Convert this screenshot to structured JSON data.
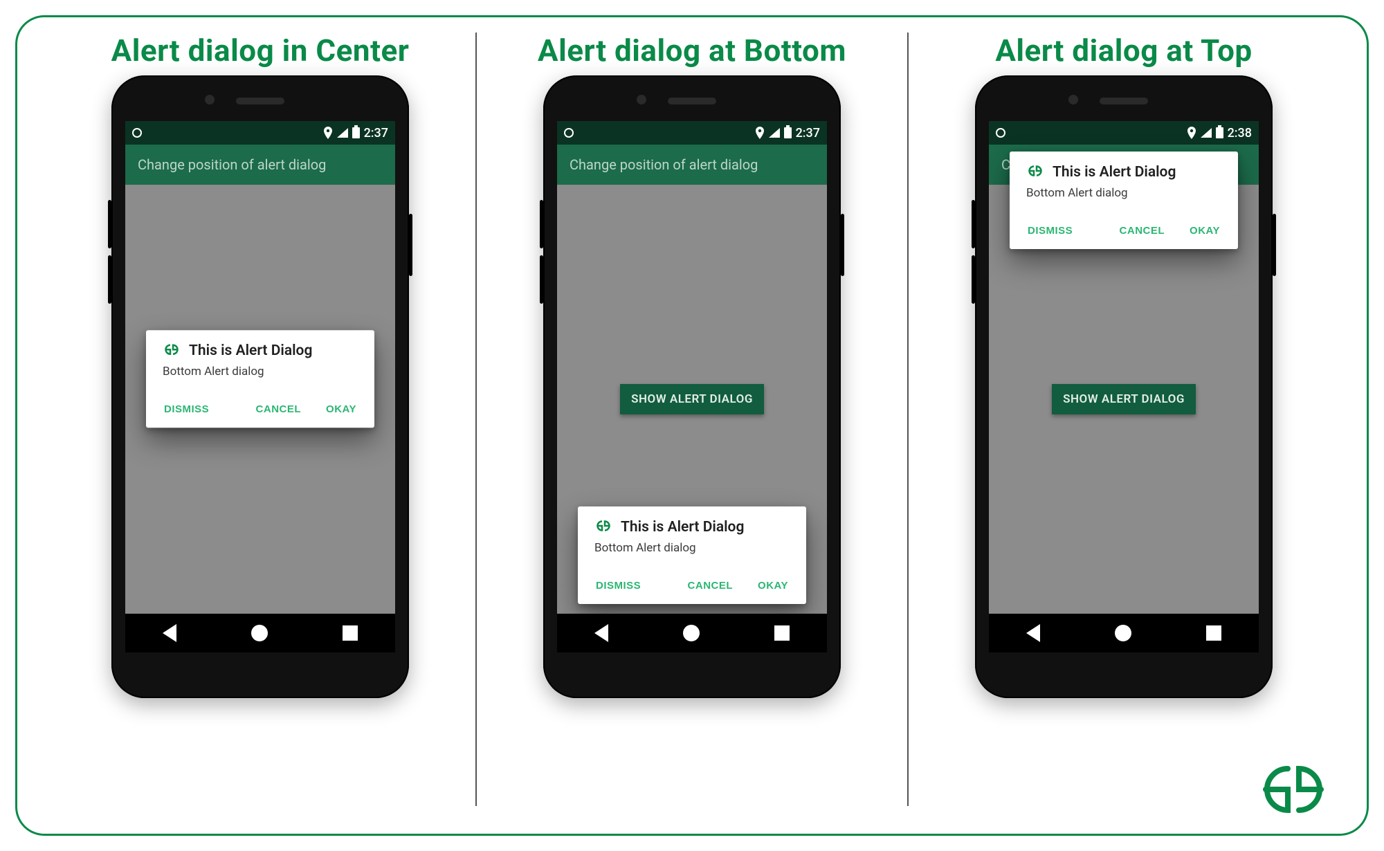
{
  "columns": [
    {
      "title": "Alert dialog in Center",
      "position": "center",
      "time": "2:37"
    },
    {
      "title": "Alert dialog at Bottom",
      "position": "bottom",
      "time": "2:37"
    },
    {
      "title": "Alert dialog at Top",
      "position": "top",
      "time": "2:38"
    }
  ],
  "appbar_title": "Change position of alert dialog",
  "show_button_label": "SHOW ALERT DIALOG",
  "dialog": {
    "title": "This is Alert Dialog",
    "message": "Bottom Alert dialog",
    "dismiss": "DISMISS",
    "cancel": "CANCEL",
    "okay": "OKAY"
  }
}
